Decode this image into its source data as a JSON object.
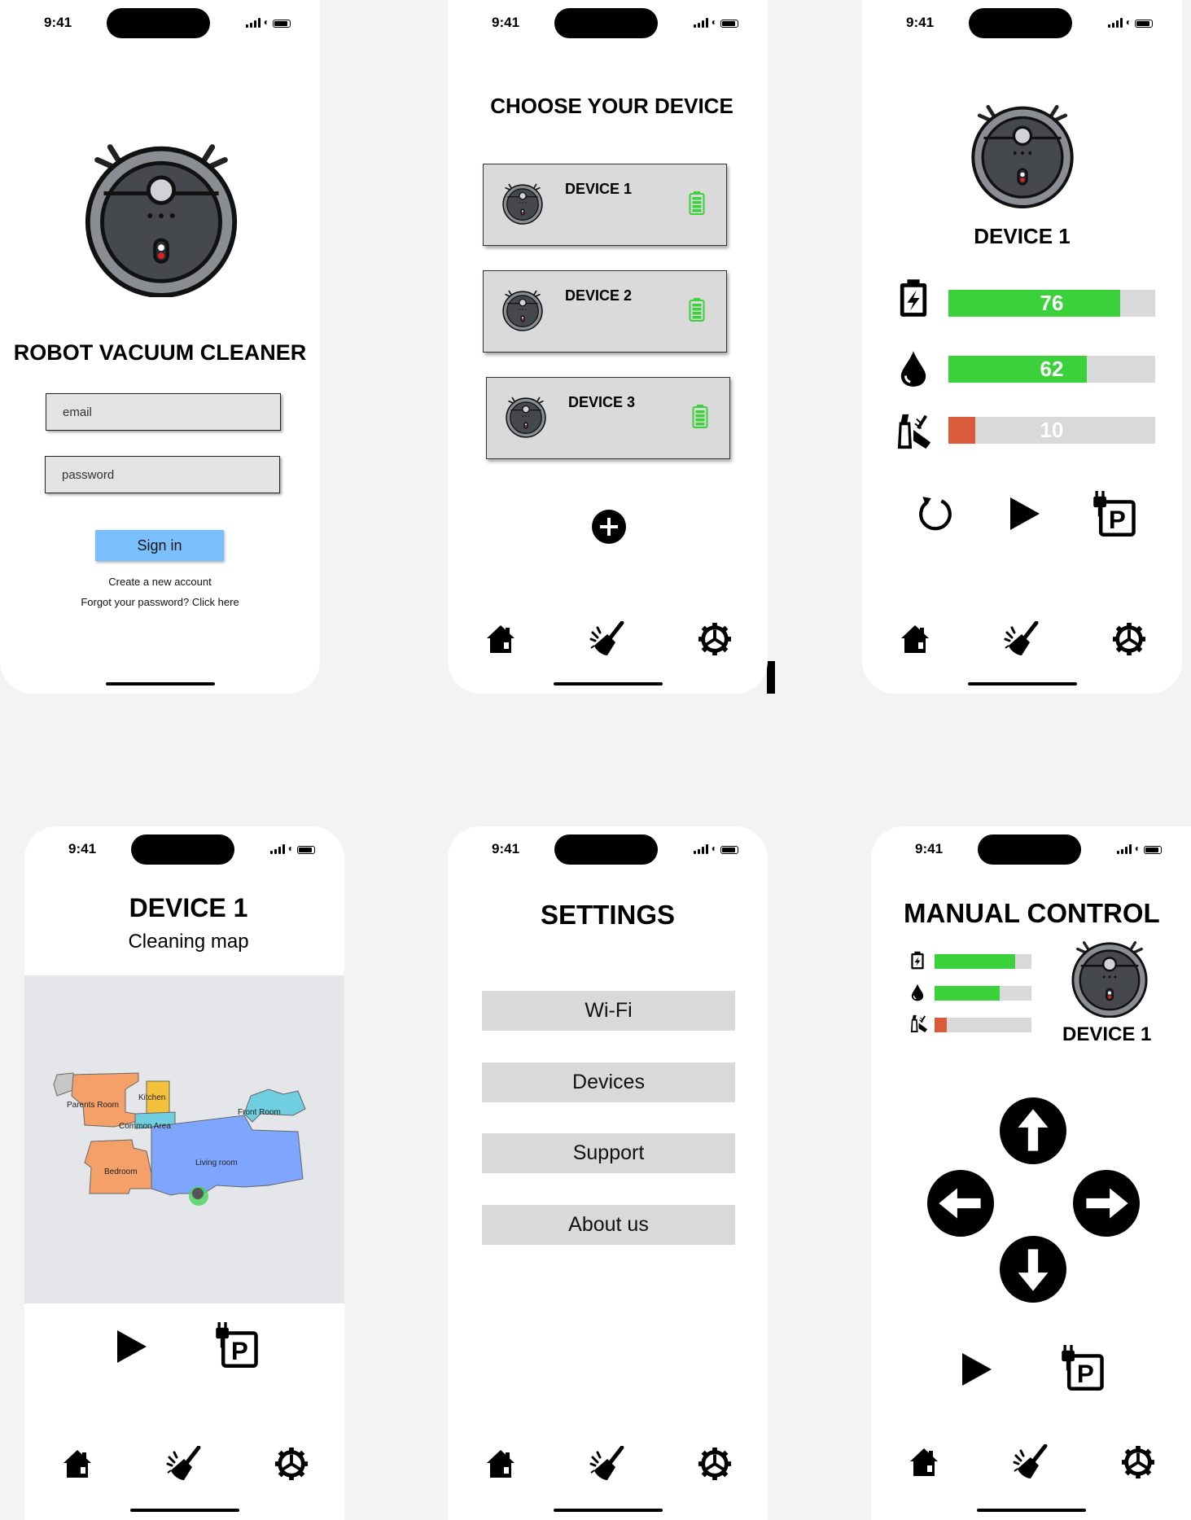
{
  "status_time": "9:41",
  "colors": {
    "green": "#3ad13a",
    "red": "#d95b3b",
    "blue": "#7ac0ff",
    "gray": "#d9d9d9"
  },
  "icons": [
    "robot-vacuum-icon",
    "battery-icon",
    "water-drop-icon",
    "cleaning-spray-icon",
    "restart-icon",
    "play-icon",
    "parking-dock-icon",
    "home-icon",
    "broom-icon",
    "gear-icon",
    "plus-icon",
    "arrow-up-icon",
    "arrow-down-icon",
    "arrow-left-icon",
    "arrow-right-icon"
  ],
  "login": {
    "title": "ROBOT VACUUM CLEANER",
    "email_placeholder": "email",
    "password_placeholder": "password",
    "signin_label": "Sign in",
    "create_account": "Create a new account",
    "forgot_password": "Forgot your password? Click here"
  },
  "choose": {
    "title": "CHOOSE YOUR DEVICE",
    "devices": [
      {
        "name": "DEVICE 1"
      },
      {
        "name": "DEVICE 2"
      },
      {
        "name": "DEVICE 3"
      }
    ]
  },
  "device_status": {
    "name": "DEVICE 1",
    "battery": {
      "value": "76",
      "level": 0.83
    },
    "water": {
      "value": "62",
      "level": 0.67
    },
    "detergent": {
      "value": "10",
      "level": 0.13
    }
  },
  "map": {
    "device_name": "DEVICE 1",
    "subtitle": "Cleaning map",
    "rooms": [
      "Parents Room",
      "Kitchen",
      "Common Area",
      "Front Room",
      "Bedroom",
      "Living room"
    ]
  },
  "settings": {
    "title": "SETTINGS",
    "items": [
      "Wi-Fi",
      "Devices",
      "Support",
      "About us"
    ]
  },
  "manual": {
    "title": "MANUAL CONTROL",
    "device_name": "DEVICE 1",
    "battery_level": 0.83,
    "water_level": 0.67,
    "detergent_level": 0.13
  }
}
